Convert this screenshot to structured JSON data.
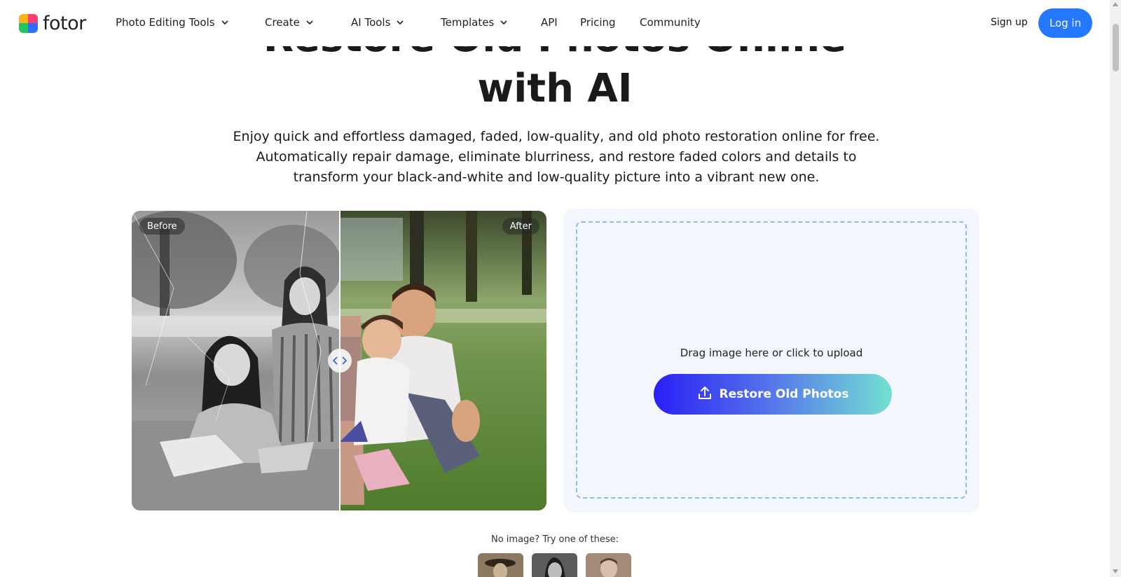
{
  "header": {
    "logo_text": "fotor",
    "nav": [
      {
        "label": "Photo Editing Tools",
        "has_dropdown": true
      },
      {
        "label": "Create",
        "has_dropdown": true
      },
      {
        "label": "AI Tools",
        "has_dropdown": true
      },
      {
        "label": "Templates",
        "has_dropdown": true
      },
      {
        "label": "API",
        "has_dropdown": false
      },
      {
        "label": "Pricing",
        "has_dropdown": false
      },
      {
        "label": "Community",
        "has_dropdown": false
      }
    ],
    "signup_label": "Sign up",
    "login_label": "Log in"
  },
  "hero": {
    "title_line1": "Restore Old Photos Online",
    "title_line2": "with AI",
    "subtitle": "Enjoy quick and effortless damaged, faded, low-quality, and old photo restoration online for free. Automatically repair damage, eliminate blurriness, and restore faded colors and details to transform your black-and-white and low-quality picture into a vibrant new one."
  },
  "compare": {
    "before_label": "Before",
    "after_label": "After"
  },
  "upload": {
    "hint": "Drag image here or click to upload",
    "button_label": "Restore Old Photos",
    "icon": "upload-icon"
  },
  "samples": {
    "prompt": "No image? Try one of these:"
  },
  "colors": {
    "accent": "#2477ff",
    "gradient_start": "#2a1ff5",
    "gradient_end": "#73e1d3",
    "panel_bg": "#f3f6fd",
    "dashed_border": "#8eb8f0"
  }
}
